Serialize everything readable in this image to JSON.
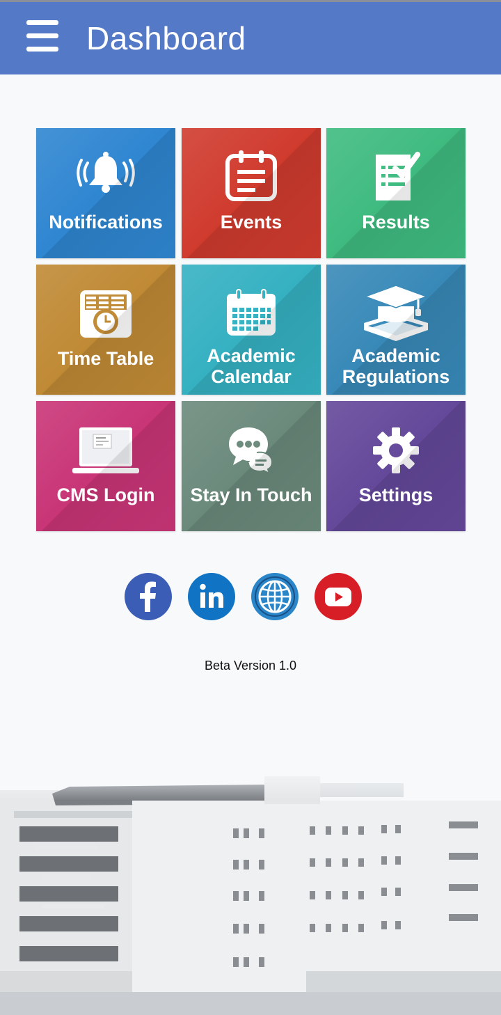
{
  "appbar": {
    "title": "Dashboard",
    "menu_icon": "hamburger-menu-icon",
    "color": "#5479c6"
  },
  "tiles": [
    {
      "id": "notifications",
      "label": "Notifications",
      "color": "#2f86d1",
      "icon": "bell-ringing-icon"
    },
    {
      "id": "events",
      "label": "Events",
      "color": "#d03b2e",
      "icon": "notepad-icon"
    },
    {
      "id": "results",
      "label": "Results",
      "color": "#3fbb80",
      "icon": "checklist-icon"
    },
    {
      "id": "time-table",
      "label": "Time Table",
      "color": "#c08a35",
      "icon": "timetable-clock-icon"
    },
    {
      "id": "academic-calendar",
      "label_line1": "Academic",
      "label_line2": "Calendar",
      "color": "#35b1c2",
      "icon": "calendar-icon"
    },
    {
      "id": "academic-regulations",
      "label_line1": "Academic",
      "label_line2": "Regulations",
      "color": "#3889b8",
      "icon": "graduation-cap-book-icon"
    },
    {
      "id": "cms-login",
      "label": "CMS Login",
      "color": "#c93577",
      "icon": "laptop-icon"
    },
    {
      "id": "stay-in-touch",
      "label": "Stay In Touch",
      "color": "#6b8a7c",
      "icon": "chat-bubbles-icon"
    },
    {
      "id": "settings",
      "label": "Settings",
      "color": "#64489a",
      "icon": "gear-icon"
    }
  ],
  "social": [
    {
      "name": "Facebook",
      "icon": "facebook-icon",
      "color": "#3b5db5"
    },
    {
      "name": "LinkedIn",
      "icon": "linkedin-icon",
      "color": "#1173c4"
    },
    {
      "name": "Website",
      "icon": "globe-icon",
      "color": "#2a86c8"
    },
    {
      "name": "YouTube",
      "icon": "youtube-icon",
      "color": "#d71d25"
    }
  ],
  "footer": {
    "version": "Beta Version 1.0"
  }
}
